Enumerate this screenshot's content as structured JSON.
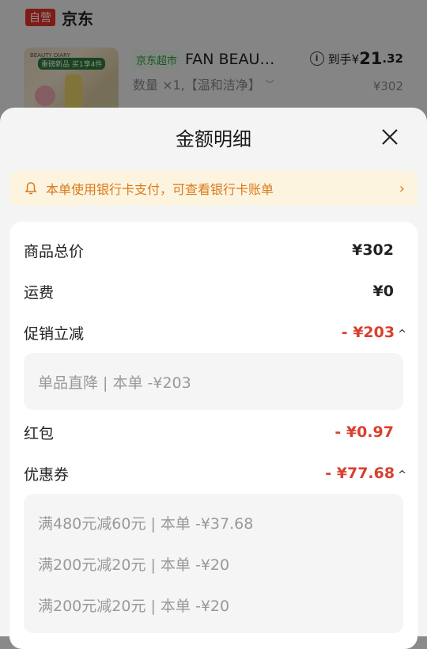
{
  "store": {
    "badge": "自营",
    "name": "京东"
  },
  "product": {
    "thumb_brand": "BEAUTY DIARY",
    "thumb_promo": "重磅新品 买1享4件",
    "market_tag": "京东超市",
    "name": "FAN BEAU…",
    "spec": "数量 ×1,【温和洁净】",
    "price_label": "到手¥",
    "price_int": "21",
    "price_dec": ".32",
    "orig_price": "¥302",
    "icons": {
      "info": "info-icon",
      "spec_expand": "chevron-down-icon"
    }
  },
  "sheet": {
    "title": "金额明细",
    "close_icon": "close-icon",
    "notice": {
      "text": "本单使用银行卡支付，可查看银行卡账单",
      "icon": "bell-icon",
      "arrow": "›",
      "color": "#d97a1a"
    },
    "rows": {
      "total": {
        "label": "商品总价",
        "value": "¥302"
      },
      "shipping": {
        "label": "运费",
        "value": "¥0"
      },
      "promo": {
        "label": "促销立减",
        "value": "- ¥203",
        "detail": [
          "单品直降 | 本单 -¥203"
        ]
      },
      "redpacket": {
        "label": "红包",
        "value": "- ¥0.97"
      },
      "coupon": {
        "label": "优惠券",
        "value": "- ¥77.68",
        "detail": [
          "满480元减60元 | 本单 -¥37.68",
          "满200元减20元 | 本单 -¥20",
          "满200元减20元 | 本单 -¥20"
        ]
      }
    },
    "caret": "^",
    "accent_red": "#d8402f"
  }
}
